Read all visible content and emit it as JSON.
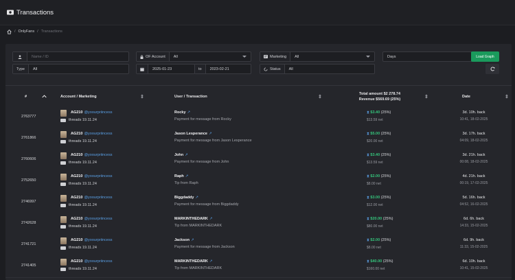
{
  "header": {
    "title": "Transactions"
  },
  "breadcrumb": {
    "home_sep": "/",
    "section": "OnlyFans",
    "sep": "/",
    "current": "Transactions"
  },
  "filters": {
    "name_placeholder": "Name / ID",
    "of_account_label": "OF Account",
    "of_account_value": "All",
    "marketing_label": "Marketing",
    "marketing_value": "All",
    "days_value": "Days",
    "load_graph": "Load Graph",
    "type_label": "Type",
    "type_value": "All",
    "date_from": "2025-01-23",
    "date_to_label": "to",
    "date_to": "2023-02-21",
    "status_label": "Status",
    "status_value": "All"
  },
  "table": {
    "col_id": "#",
    "col_account": "Account / Marketing",
    "col_user": "User / Transaction",
    "col_total": "Total amount $2 278.74",
    "col_revenue": "Revenue $569.69 (25%)",
    "col_date": "Date",
    "rows": [
      {
        "id": "2763777",
        "acct": "AG210",
        "handle": "@yoourpriincess",
        "thread": "threads 19.11.24",
        "user": "Rocky",
        "desc": "Payment for message from Rocky",
        "amount": "$3.40",
        "pct": "(25%)",
        "net": "$13.59 net",
        "ago": "3d. 10h. back",
        "ts": "10:41, 18-02-2025"
      },
      {
        "id": "2761866",
        "acct": "AG210",
        "handle": "@yoourpriincess",
        "thread": "threads 19.11.24",
        "user": "Jason Lesperance",
        "desc": "Payment for message from Jason Lesperance",
        "amount": "$5.00",
        "pct": "(25%)",
        "net": "$20.00 net",
        "ago": "3d. 17h. back",
        "ts": "04:09, 18-02-2025"
      },
      {
        "id": "2760606",
        "acct": "AG210",
        "handle": "@yoourpriincess",
        "thread": "threads 19.11.24",
        "user": "John",
        "desc": "Payment for message from John",
        "amount": "$3.40",
        "pct": "(25%)",
        "net": "$13.59 net",
        "ago": "3d. 21h. back",
        "ts": "00:08, 18-02-2025"
      },
      {
        "id": "2752650",
        "acct": "AG210",
        "handle": "@yoourpriincess",
        "thread": "threads 19.11.24",
        "user": "Raph",
        "desc": "Tip from Raph",
        "amount": "$2.00",
        "pct": "(25%)",
        "net": "$8.00 net",
        "ago": "4d. 21h. back",
        "ts": "00:19, 17-02-2025"
      },
      {
        "id": "2746997",
        "acct": "AG210",
        "handle": "@yoourpriincess",
        "thread": "threads 19.11.24",
        "user": "Biggdaddy",
        "desc": "Payment for message from Biggdaddy",
        "amount": "$3.00",
        "pct": "(25%)",
        "net": "$12.00 net",
        "ago": "5d. 16h. back",
        "ts": "04:52, 16-02-2025"
      },
      {
        "id": "2742628",
        "acct": "AG210",
        "handle": "@yoourpriincess",
        "thread": "threads 19.11.24",
        "user": "MARKINTHEDARK",
        "desc": "Tip from MARKINTHEDARK",
        "amount": "$20.00",
        "pct": "(25%)",
        "net": "$80.00 net",
        "ago": "6d. 6h. back",
        "ts": "14:33, 15-02-2025"
      },
      {
        "id": "2741721",
        "acct": "AG210",
        "handle": "@yoourpriincess",
        "thread": "threads 19.11.24",
        "user": "Jackson",
        "desc": "Payment for message from Jackson",
        "amount": "$2.00",
        "pct": "(25%)",
        "net": "$8.00 net",
        "ago": "6d. 9h. back",
        "ts": "11:33, 15-02-2025"
      },
      {
        "id": "2741405",
        "acct": "AG210",
        "handle": "@yoourpriincess",
        "thread": "threads 19.11.24",
        "user": "MARKINTHEDARK",
        "desc": "Tip from MARKINTHEDARK",
        "amount": "$40.00",
        "pct": "(25%)",
        "net": "$160.00 net",
        "ago": "6d. 10h. back",
        "ts": "10:41, 15-02-2025"
      }
    ]
  }
}
